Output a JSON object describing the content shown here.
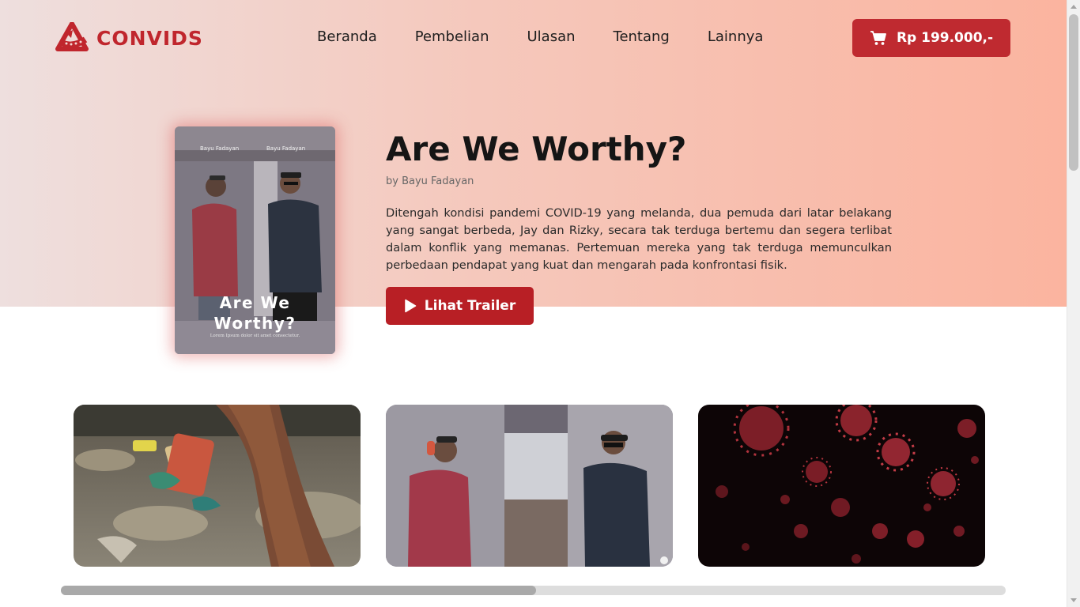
{
  "brand": {
    "name": "CONVIDS",
    "color": "#c0262d",
    "icon": "film-reel-icon"
  },
  "nav": {
    "items": [
      {
        "label": "Beranda"
      },
      {
        "label": "Pembelian"
      },
      {
        "label": "Ulasan"
      },
      {
        "label": "Tentang"
      },
      {
        "label": "Lainnya"
      }
    ]
  },
  "cart": {
    "icon": "cart-icon",
    "total": "Rp 199.000,-"
  },
  "movie": {
    "title": "Are We Worthy?",
    "author": "by Bayu Fadayan",
    "synopsis": "Ditengah kondisi pandemi COVID-19 yang melanda, dua pemuda dari latar belakang yang sangat berbeda, Jay dan Rizky, secara tak terduga bertemu dan segera terlibat dalam konflik yang memanas. Pertemuan mereka yang tak terduga memunculkan perbedaan pendapat yang kuat dan mengarah pada konfrontasi fisik.",
    "trailer_label": "Lihat Trailer",
    "trailer_icon": "play-icon",
    "poster": {
      "credit_left": "Bayu Fadayan",
      "credit_right": "Bayu Fadayan",
      "title_line1": "Are We",
      "title_line2": "Worthy?",
      "tagline": "Lorem Ipsum dolor sit amet consectetur."
    }
  },
  "gallery": {
    "items": [
      {
        "scene": "trash-on-beach"
      },
      {
        "scene": "two-men-in-alley"
      },
      {
        "scene": "red-virus-particles"
      }
    ],
    "scroll_progress": 0.5
  },
  "colors": {
    "accent": "#c0262d",
    "button": "#b81f25",
    "hero_gradient_start": "#eedfde",
    "hero_gradient_end": "#fbb49f"
  }
}
